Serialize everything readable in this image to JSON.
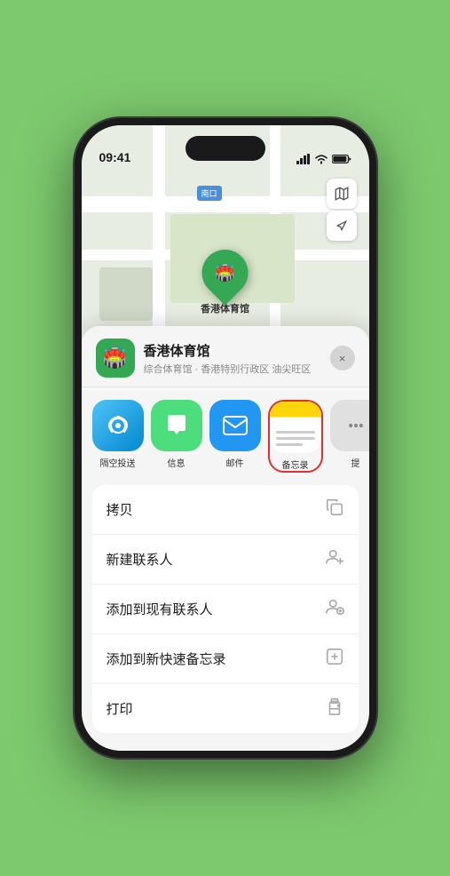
{
  "status_bar": {
    "time": "09:41",
    "signal_icon": "signal-icon",
    "wifi_icon": "wifi-icon",
    "battery_icon": "battery-icon"
  },
  "map": {
    "label": "南口",
    "controls": {
      "map_type_icon": "🗺",
      "location_icon": "➤"
    }
  },
  "pin": {
    "label": "香港体育馆"
  },
  "sheet": {
    "venue_name": "香港体育馆",
    "venue_desc": "综合体育馆 · 香港特别行政区 油尖旺区",
    "close_label": "×"
  },
  "share_items": [
    {
      "id": "airdrop",
      "label": "隔空投送",
      "type": "airdrop"
    },
    {
      "id": "message",
      "label": "信息",
      "type": "message"
    },
    {
      "id": "mail",
      "label": "邮件",
      "type": "mail"
    },
    {
      "id": "notes",
      "label": "备忘录",
      "type": "notes",
      "selected": true
    },
    {
      "id": "more",
      "label": "提",
      "type": "more"
    }
  ],
  "actions": [
    {
      "label": "拷贝",
      "icon": "copy"
    },
    {
      "label": "新建联系人",
      "icon": "person-add"
    },
    {
      "label": "添加到现有联系人",
      "icon": "person-plus"
    },
    {
      "label": "添加到新快速备忘录",
      "icon": "note-add"
    },
    {
      "label": "打印",
      "icon": "print"
    }
  ]
}
